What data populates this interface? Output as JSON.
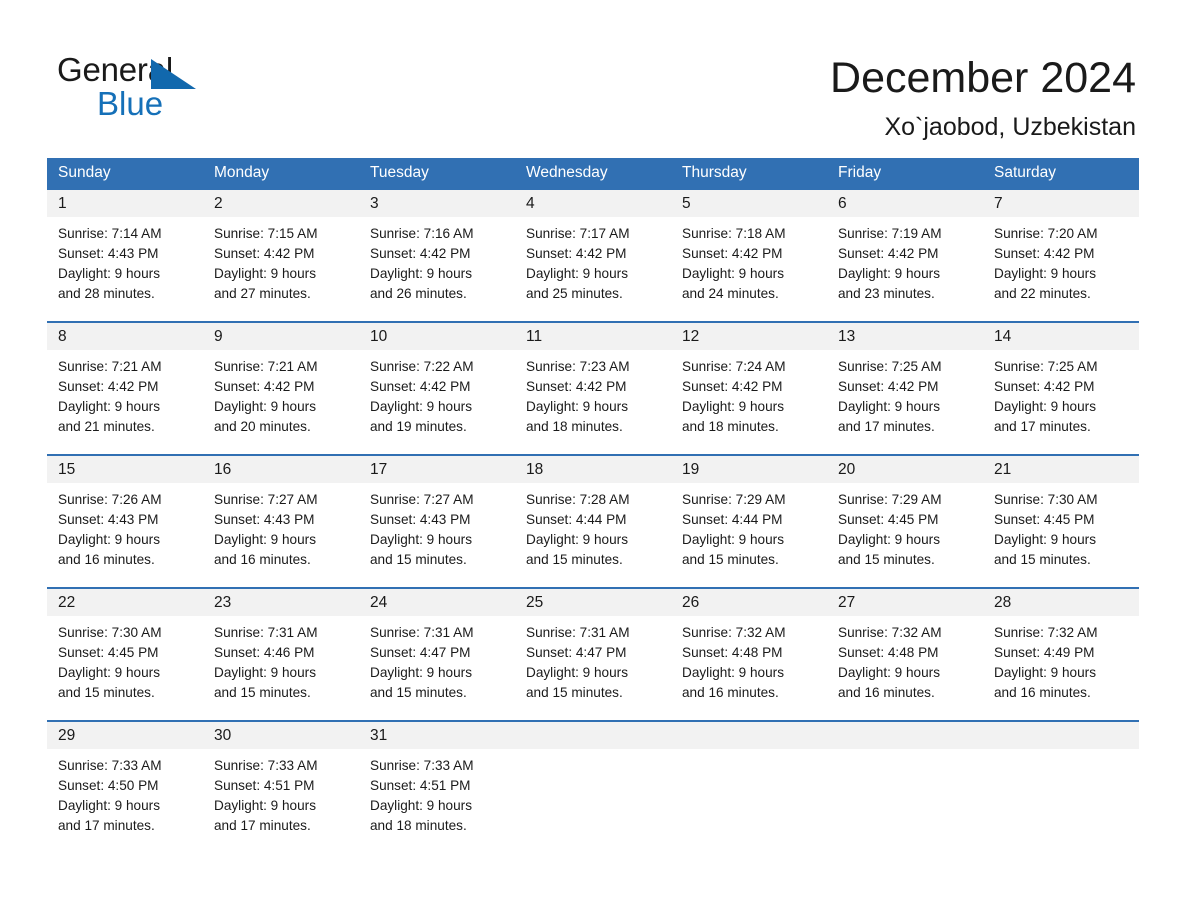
{
  "brand": {
    "name_part1": "General",
    "name_part2": "Blue",
    "triangle_color": "#1168ad",
    "blue_color": "#1570b8"
  },
  "header": {
    "title": "December 2024",
    "location": "Xo`jaobod, Uzbekistan"
  },
  "theme": {
    "header_blue": "#3170b3",
    "date_strip_gray": "#f2f2f2",
    "text_color": "#1a1a1a"
  },
  "weekdays": [
    "Sunday",
    "Monday",
    "Tuesday",
    "Wednesday",
    "Thursday",
    "Friday",
    "Saturday"
  ],
  "weeks": [
    [
      {
        "day": "1",
        "sunrise": "Sunrise: 7:14 AM",
        "sunset": "Sunset: 4:43 PM",
        "daylight_line1": "Daylight: 9 hours",
        "daylight_line2": "and 28 minutes."
      },
      {
        "day": "2",
        "sunrise": "Sunrise: 7:15 AM",
        "sunset": "Sunset: 4:42 PM",
        "daylight_line1": "Daylight: 9 hours",
        "daylight_line2": "and 27 minutes."
      },
      {
        "day": "3",
        "sunrise": "Sunrise: 7:16 AM",
        "sunset": "Sunset: 4:42 PM",
        "daylight_line1": "Daylight: 9 hours",
        "daylight_line2": "and 26 minutes."
      },
      {
        "day": "4",
        "sunrise": "Sunrise: 7:17 AM",
        "sunset": "Sunset: 4:42 PM",
        "daylight_line1": "Daylight: 9 hours",
        "daylight_line2": "and 25 minutes."
      },
      {
        "day": "5",
        "sunrise": "Sunrise: 7:18 AM",
        "sunset": "Sunset: 4:42 PM",
        "daylight_line1": "Daylight: 9 hours",
        "daylight_line2": "and 24 minutes."
      },
      {
        "day": "6",
        "sunrise": "Sunrise: 7:19 AM",
        "sunset": "Sunset: 4:42 PM",
        "daylight_line1": "Daylight: 9 hours",
        "daylight_line2": "and 23 minutes."
      },
      {
        "day": "7",
        "sunrise": "Sunrise: 7:20 AM",
        "sunset": "Sunset: 4:42 PM",
        "daylight_line1": "Daylight: 9 hours",
        "daylight_line2": "and 22 minutes."
      }
    ],
    [
      {
        "day": "8",
        "sunrise": "Sunrise: 7:21 AM",
        "sunset": "Sunset: 4:42 PM",
        "daylight_line1": "Daylight: 9 hours",
        "daylight_line2": "and 21 minutes."
      },
      {
        "day": "9",
        "sunrise": "Sunrise: 7:21 AM",
        "sunset": "Sunset: 4:42 PM",
        "daylight_line1": "Daylight: 9 hours",
        "daylight_line2": "and 20 minutes."
      },
      {
        "day": "10",
        "sunrise": "Sunrise: 7:22 AM",
        "sunset": "Sunset: 4:42 PM",
        "daylight_line1": "Daylight: 9 hours",
        "daylight_line2": "and 19 minutes."
      },
      {
        "day": "11",
        "sunrise": "Sunrise: 7:23 AM",
        "sunset": "Sunset: 4:42 PM",
        "daylight_line1": "Daylight: 9 hours",
        "daylight_line2": "and 18 minutes."
      },
      {
        "day": "12",
        "sunrise": "Sunrise: 7:24 AM",
        "sunset": "Sunset: 4:42 PM",
        "daylight_line1": "Daylight: 9 hours",
        "daylight_line2": "and 18 minutes."
      },
      {
        "day": "13",
        "sunrise": "Sunrise: 7:25 AM",
        "sunset": "Sunset: 4:42 PM",
        "daylight_line1": "Daylight: 9 hours",
        "daylight_line2": "and 17 minutes."
      },
      {
        "day": "14",
        "sunrise": "Sunrise: 7:25 AM",
        "sunset": "Sunset: 4:42 PM",
        "daylight_line1": "Daylight: 9 hours",
        "daylight_line2": "and 17 minutes."
      }
    ],
    [
      {
        "day": "15",
        "sunrise": "Sunrise: 7:26 AM",
        "sunset": "Sunset: 4:43 PM",
        "daylight_line1": "Daylight: 9 hours",
        "daylight_line2": "and 16 minutes."
      },
      {
        "day": "16",
        "sunrise": "Sunrise: 7:27 AM",
        "sunset": "Sunset: 4:43 PM",
        "daylight_line1": "Daylight: 9 hours",
        "daylight_line2": "and 16 minutes."
      },
      {
        "day": "17",
        "sunrise": "Sunrise: 7:27 AM",
        "sunset": "Sunset: 4:43 PM",
        "daylight_line1": "Daylight: 9 hours",
        "daylight_line2": "and 15 minutes."
      },
      {
        "day": "18",
        "sunrise": "Sunrise: 7:28 AM",
        "sunset": "Sunset: 4:44 PM",
        "daylight_line1": "Daylight: 9 hours",
        "daylight_line2": "and 15 minutes."
      },
      {
        "day": "19",
        "sunrise": "Sunrise: 7:29 AM",
        "sunset": "Sunset: 4:44 PM",
        "daylight_line1": "Daylight: 9 hours",
        "daylight_line2": "and 15 minutes."
      },
      {
        "day": "20",
        "sunrise": "Sunrise: 7:29 AM",
        "sunset": "Sunset: 4:45 PM",
        "daylight_line1": "Daylight: 9 hours",
        "daylight_line2": "and 15 minutes."
      },
      {
        "day": "21",
        "sunrise": "Sunrise: 7:30 AM",
        "sunset": "Sunset: 4:45 PM",
        "daylight_line1": "Daylight: 9 hours",
        "daylight_line2": "and 15 minutes."
      }
    ],
    [
      {
        "day": "22",
        "sunrise": "Sunrise: 7:30 AM",
        "sunset": "Sunset: 4:45 PM",
        "daylight_line1": "Daylight: 9 hours",
        "daylight_line2": "and 15 minutes."
      },
      {
        "day": "23",
        "sunrise": "Sunrise: 7:31 AM",
        "sunset": "Sunset: 4:46 PM",
        "daylight_line1": "Daylight: 9 hours",
        "daylight_line2": "and 15 minutes."
      },
      {
        "day": "24",
        "sunrise": "Sunrise: 7:31 AM",
        "sunset": "Sunset: 4:47 PM",
        "daylight_line1": "Daylight: 9 hours",
        "daylight_line2": "and 15 minutes."
      },
      {
        "day": "25",
        "sunrise": "Sunrise: 7:31 AM",
        "sunset": "Sunset: 4:47 PM",
        "daylight_line1": "Daylight: 9 hours",
        "daylight_line2": "and 15 minutes."
      },
      {
        "day": "26",
        "sunrise": "Sunrise: 7:32 AM",
        "sunset": "Sunset: 4:48 PM",
        "daylight_line1": "Daylight: 9 hours",
        "daylight_line2": "and 16 minutes."
      },
      {
        "day": "27",
        "sunrise": "Sunrise: 7:32 AM",
        "sunset": "Sunset: 4:48 PM",
        "daylight_line1": "Daylight: 9 hours",
        "daylight_line2": "and 16 minutes."
      },
      {
        "day": "28",
        "sunrise": "Sunrise: 7:32 AM",
        "sunset": "Sunset: 4:49 PM",
        "daylight_line1": "Daylight: 9 hours",
        "daylight_line2": "and 16 minutes."
      }
    ],
    [
      {
        "day": "29",
        "sunrise": "Sunrise: 7:33 AM",
        "sunset": "Sunset: 4:50 PM",
        "daylight_line1": "Daylight: 9 hours",
        "daylight_line2": "and 17 minutes."
      },
      {
        "day": "30",
        "sunrise": "Sunrise: 7:33 AM",
        "sunset": "Sunset: 4:51 PM",
        "daylight_line1": "Daylight: 9 hours",
        "daylight_line2": "and 17 minutes."
      },
      {
        "day": "31",
        "sunrise": "Sunrise: 7:33 AM",
        "sunset": "Sunset: 4:51 PM",
        "daylight_line1": "Daylight: 9 hours",
        "daylight_line2": "and 18 minutes."
      },
      {
        "day": "",
        "sunrise": "",
        "sunset": "",
        "daylight_line1": "",
        "daylight_line2": ""
      },
      {
        "day": "",
        "sunrise": "",
        "sunset": "",
        "daylight_line1": "",
        "daylight_line2": ""
      },
      {
        "day": "",
        "sunrise": "",
        "sunset": "",
        "daylight_line1": "",
        "daylight_line2": ""
      },
      {
        "day": "",
        "sunrise": "",
        "sunset": "",
        "daylight_line1": "",
        "daylight_line2": ""
      }
    ]
  ]
}
